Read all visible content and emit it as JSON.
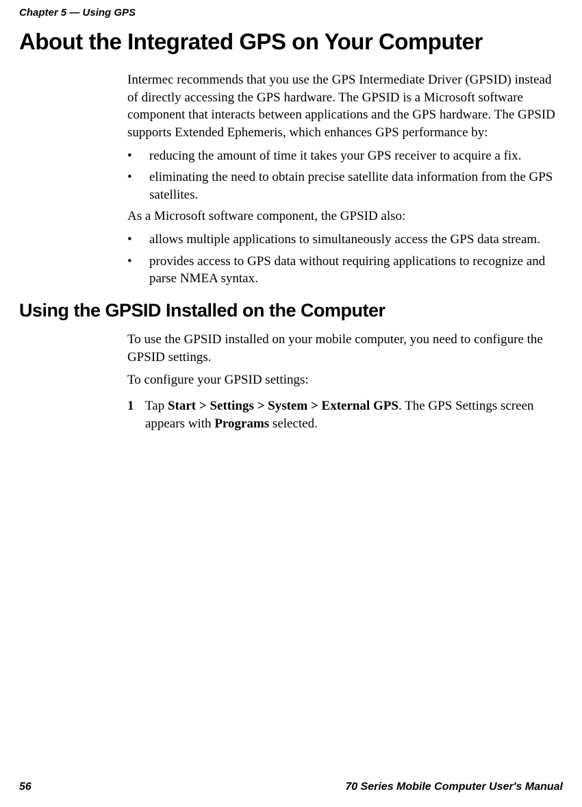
{
  "header": {
    "chapter": "Chapter 5 — Using GPS"
  },
  "section1": {
    "title": "About the Integrated GPS on Your Computer",
    "intro": "Intermec recommends that you use the GPS Intermediate Driver (GPSID) instead of directly accessing the GPS hardware. The GPSID is a Microsoft software component that interacts between applications and the GPS hardware. The GPSID supports Extended Ephemeris, which enhances GPS performance by:",
    "bullets1": [
      "reducing the amount of time it takes your GPS receiver to acquire a fix.",
      "eliminating the need to obtain precise satellite data information from the GPS satellites."
    ],
    "mid": "As a Microsoft software component, the GPSID also:",
    "bullets2": [
      "allows multiple applications to simultaneously access the GPS data stream.",
      "provides access to GPS data without requiring applications to recognize and parse NMEA syntax."
    ]
  },
  "section2": {
    "title": "Using the GPSID Installed on the Computer",
    "para1": "To use the GPSID installed on your mobile computer, you need to configure the GPSID settings.",
    "para2": "To configure your GPSID settings:",
    "step1_num": "1",
    "step1_pre": "Tap ",
    "step1_bold1": "Start > Settings > System > External GPS",
    "step1_mid": ". The GPS Settings screen appears with ",
    "step1_bold2": "Programs",
    "step1_post": " selected."
  },
  "footer": {
    "page": "56",
    "manual": "70 Series Mobile Computer User's Manual"
  },
  "glyphs": {
    "bullet": "•"
  }
}
